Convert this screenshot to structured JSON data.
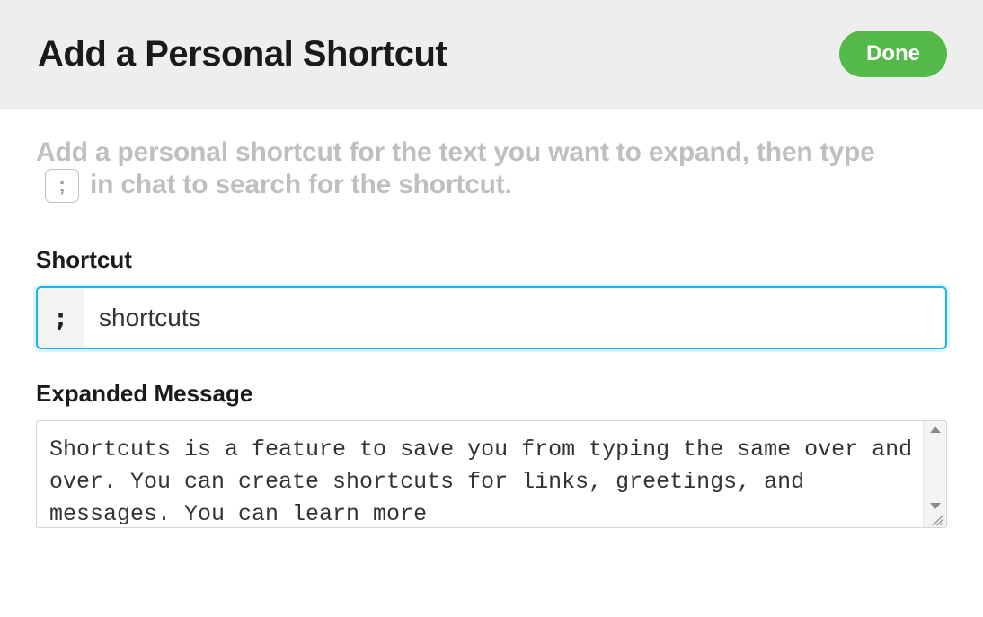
{
  "header": {
    "title": "Add a Personal Shortcut",
    "done_label": "Done"
  },
  "instructions": {
    "line1": "Add a personal shortcut for the text you want to expand, then type",
    "trigger_key": ";",
    "line2_rest": "in chat to search for the shortcut."
  },
  "shortcut": {
    "label": "Shortcut",
    "prefix": ";",
    "value": "shortcuts"
  },
  "expanded": {
    "label": "Expanded Message",
    "value": "Shortcuts is a feature to save you from typing the same over and over. You can create shortcuts for links, greetings, and messages. You can learn more"
  }
}
